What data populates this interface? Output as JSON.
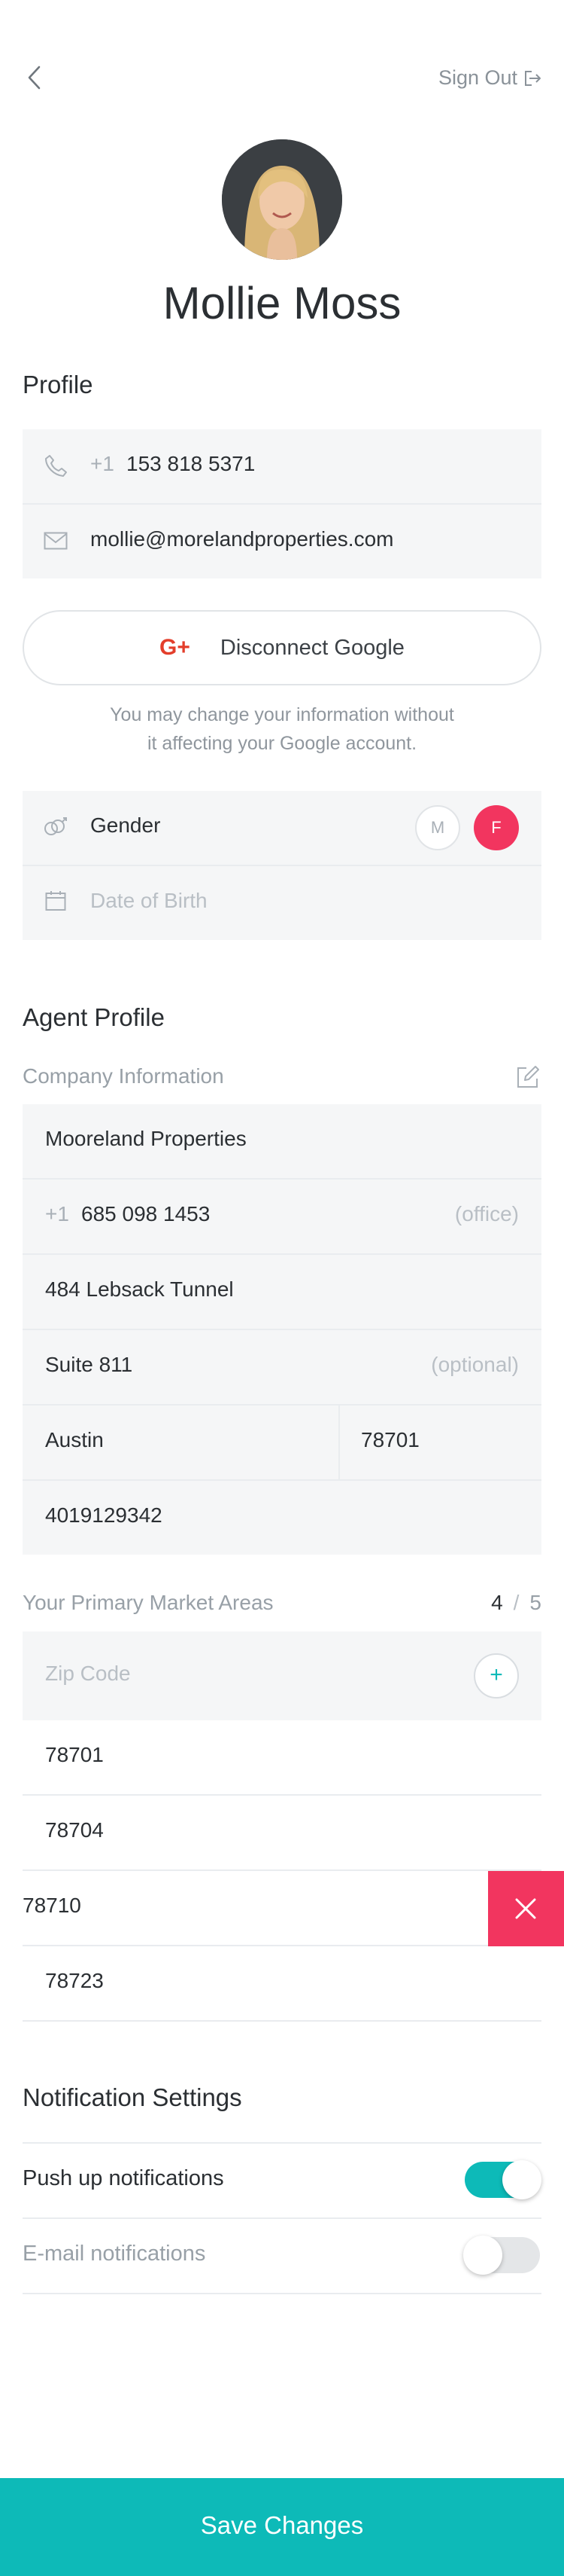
{
  "header": {
    "sign_out": "Sign Out"
  },
  "profile": {
    "name": "Mollie Moss"
  },
  "sections": {
    "profile": "Profile",
    "agent_profile": "Agent Profile",
    "notifications": "Notification Settings"
  },
  "contact": {
    "country_code": "+1",
    "phone": "153 818 5371",
    "email": "mollie@morelandproperties.com"
  },
  "google": {
    "button_label": "Disconnect Google",
    "note_line1": "You may change your information without",
    "note_line2": "it affecting your Google account."
  },
  "personal": {
    "gender_label": "Gender",
    "gender_m": "M",
    "gender_f": "F",
    "gender_selected": "F",
    "dob_placeholder": "Date of Birth"
  },
  "company": {
    "heading": "Company Information",
    "name": "Mooreland Properties",
    "country_code": "+1",
    "phone": "685 098 1453",
    "phone_hint": "(office)",
    "address1": "484 Lebsack Tunnel",
    "address2": "Suite 811",
    "address2_hint": "(optional)",
    "city": "Austin",
    "zip": "78701",
    "license": "4019129342"
  },
  "markets": {
    "heading": "Your Primary Market Areas",
    "count": "4",
    "separator": "/",
    "max": "5",
    "zip_placeholder": "Zip Code",
    "zips": [
      "78701",
      "78704",
      "78710",
      "78723"
    ]
  },
  "notifications": {
    "push_label": "Push up notifications",
    "push_on": true,
    "email_label": "E-mail notifications",
    "email_on": false
  },
  "footer": {
    "save_label": "Save Changes"
  },
  "colors": {
    "teal": "#0dbab8",
    "pink": "#f2355f",
    "text": "#2b2f33",
    "muted": "#a9b0b7"
  }
}
